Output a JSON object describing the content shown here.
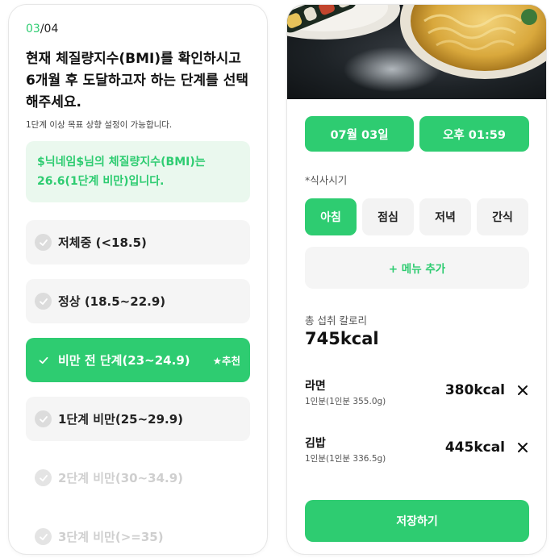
{
  "step": {
    "current": "03",
    "total": "/04"
  },
  "question": {
    "title": "현재 체질량지수(BMI)를 확인하시고\n6개월 후 도달하고자 하는 단계를 선택\n해주세요.",
    "subtitle": "1단계 이상 목표 상향 설정이 가능합니다."
  },
  "bmi_notice": "$닉네임$님의 체질량지수(BMI)는\n26.6(1단계 비만)입니다.",
  "options": [
    {
      "label": "저체중 (<18.5)"
    },
    {
      "label": "정상 (18.5~22.9)"
    },
    {
      "label": "비만 전 단계(23~24.9)",
      "badge": "★추천"
    },
    {
      "label": "1단계 비만(25~29.9)"
    },
    {
      "label": "2단계 비만(30~34.9)"
    },
    {
      "label": "3단계 비만(>=35)"
    }
  ],
  "meal": {
    "date": "07월 03일",
    "time": "오후 01:59",
    "meal_time_label": "*식사시기",
    "tabs": [
      "아침",
      "점심",
      "저녁",
      "간식"
    ],
    "active_tab": "아침",
    "add_menu": "+ 메뉴 추가",
    "total_label": "총 섭취 칼로리",
    "total_value": "745kcal",
    "foods": [
      {
        "name": "라면",
        "portion": "1인분(1인분 355.0g)",
        "kcal": "380kcal"
      },
      {
        "name": "김밥",
        "portion": "1인분(1인분 336.5g)",
        "kcal": "445kcal"
      }
    ],
    "save_label": "저장하기"
  },
  "colors": {
    "accent": "#2ecc71",
    "accent_light": "#eaf8ee",
    "option_bg": "#f5f5f5"
  },
  "icons": {
    "check": "check-icon",
    "close": "close-icon"
  }
}
